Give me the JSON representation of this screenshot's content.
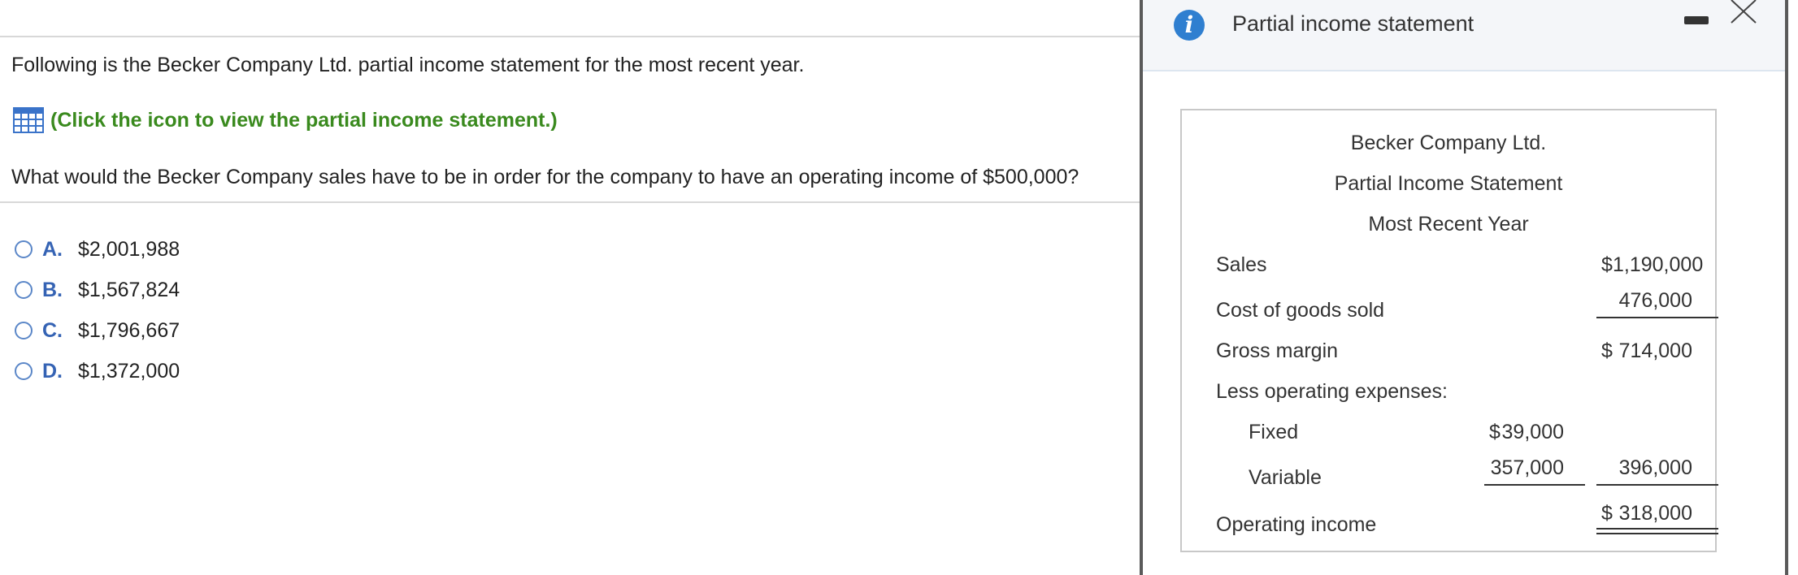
{
  "question": {
    "intro": "Following is the Becker Company Ltd. partial income statement for the most recent year.",
    "link_text": "(Click the icon to view the partial income statement.)",
    "prompt": "What would the Becker Company sales have to be in order for the company to have an operating income of $500,000?"
  },
  "options": [
    {
      "letter": "A.",
      "value": "$2,001,988"
    },
    {
      "letter": "B.",
      "value": "$1,567,824"
    },
    {
      "letter": "C.",
      "value": "$1,796,667"
    },
    {
      "letter": "D.",
      "value": "$1,372,000"
    }
  ],
  "panel": {
    "title": "Partial income statement",
    "info_icon": "info-icon",
    "minimize_icon": "minimize-icon",
    "close_icon": "close-icon"
  },
  "statement": {
    "company": "Becker Company Ltd.",
    "name": "Partial Income Statement",
    "period": "Most Recent Year",
    "rows": {
      "sales": {
        "label": "Sales",
        "dollar": "$",
        "value": "1,190,000"
      },
      "cogs": {
        "label": "Cost of goods sold",
        "value": "476,000"
      },
      "gross_margin": {
        "label": "Gross margin",
        "dollar": "$",
        "value": "714,000"
      },
      "less_opex": {
        "label": "Less operating expenses:"
      },
      "fixed": {
        "label": "Fixed",
        "dollar": "$",
        "value": "39,000"
      },
      "variable": {
        "label": "Variable",
        "value": "357,000",
        "total": "396,000"
      },
      "operating_income": {
        "label": "Operating income",
        "dollar": "$",
        "value": "318,000"
      }
    }
  },
  "colors": {
    "link_green": "#3a8a1e",
    "option_blue": "#3563b4",
    "info_blue": "#2f7fd0"
  }
}
